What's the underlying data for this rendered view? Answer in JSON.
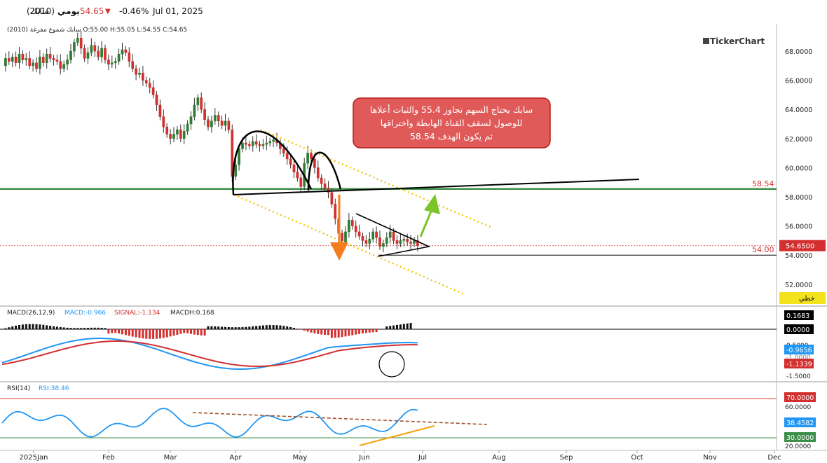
{
  "header": {
    "symbol": "سابك",
    "code": "(2010)",
    "period": "يومي",
    "price": "54.65",
    "change": "-0.46%",
    "date": "Jul 01, 2025",
    "ohlc_line": "سابك شموع مفرغة (2010) O:55.00 H:55.05 L:54.55 C:54.65",
    "brand": "TickerChart",
    "colors": {
      "down": "#d32f2f",
      "up": "#2e7d32"
    }
  },
  "annotation": {
    "line1": "سابك يحتاج السهم تجاوز 55.4 والثبات أعلاها",
    "line2": "للوصول لسقف القناة الهابطة واختراقها",
    "line3": "ثم يكون الهدف 58.54",
    "bg": "#e05a5a"
  },
  "levels": {
    "target_label": "58.54",
    "support_label": "54.00",
    "last_price_label": "54.6500",
    "linear_label": "خطي"
  },
  "price_axis": [
    "68.0000",
    "66.0000",
    "64.0000",
    "62.0000",
    "60.0000",
    "58.0000",
    "56.0000",
    "54.0000",
    "52.0000"
  ],
  "macd": {
    "title": "MACD(26,12,9)",
    "macd_label": "MACD:-0.966",
    "signal_label": "SIGNAL:-1.134",
    "hist_label": "MACDH:0.168",
    "axis": [
      "0.5000",
      "-1.5000"
    ],
    "axis_mid": "-1.0000",
    "tags": [
      "0.1683",
      "0.0000",
      "-0.9656",
      "-1.1339"
    ]
  },
  "rsi": {
    "title": "RSI(14)",
    "value_label": "RSI:38.46",
    "axis": [
      "60.0000",
      "20.0000"
    ],
    "tags": [
      "70.0000",
      "38.4582",
      "30.0000"
    ]
  },
  "x_axis": [
    "2025Jan",
    "Feb",
    "Mar",
    "Apr",
    "May",
    "Jun",
    "Jul",
    "Aug",
    "Sep",
    "Oct",
    "Nov",
    "Dec"
  ],
  "chart_data": {
    "type": "candlestick",
    "symbol": "سابك (2010)",
    "x_months": [
      "2025Jan",
      "Feb",
      "Mar",
      "Apr",
      "May",
      "Jun",
      "Jul",
      "Aug",
      "Sep",
      "Oct",
      "Nov",
      "Dec"
    ],
    "ylim": [
      51,
      69
    ],
    "last_ohlc": {
      "open": 55.0,
      "high": 55.05,
      "low": 54.55,
      "close": 54.65
    },
    "price_path": [
      [
        0,
        67.0
      ],
      [
        1,
        67.5
      ],
      [
        2,
        67.3
      ],
      [
        3,
        67.6
      ],
      [
        4,
        67.2
      ],
      [
        5,
        67.8
      ],
      [
        6,
        67.4
      ],
      [
        7,
        67.5
      ],
      [
        8,
        67.0
      ],
      [
        9,
        67.2
      ],
      [
        10,
        66.8
      ],
      [
        11,
        67.6
      ],
      [
        12,
        67.2
      ],
      [
        13,
        67.8
      ],
      [
        14,
        67.5
      ],
      [
        15,
        67.4
      ],
      [
        16,
        67.3
      ],
      [
        17,
        66.8
      ],
      [
        18,
        67.1
      ],
      [
        19,
        67.4
      ],
      [
        20,
        68.0
      ],
      [
        21,
        68.6
      ],
      [
        22,
        68.9
      ],
      [
        23,
        68.2
      ],
      [
        24,
        67.5
      ],
      [
        25,
        67.9
      ],
      [
        26,
        68.4
      ],
      [
        27,
        68.0
      ],
      [
        28,
        67.6
      ],
      [
        29,
        68.2
      ],
      [
        30,
        67.4
      ],
      [
        31,
        67.1
      ],
      [
        32,
        67.2
      ],
      [
        33,
        67.3
      ],
      [
        34,
        67.8
      ],
      [
        35,
        68.1
      ],
      [
        36,
        67.9
      ],
      [
        37,
        67.3
      ],
      [
        38,
        66.8
      ],
      [
        39,
        66.4
      ],
      [
        40,
        66.5
      ],
      [
        41,
        66.0
      ],
      [
        42,
        65.8
      ],
      [
        43,
        65.5
      ],
      [
        44,
        65.0
      ],
      [
        45,
        64.3
      ],
      [
        46,
        63.5
      ],
      [
        47,
        62.8
      ],
      [
        48,
        62.3
      ],
      [
        49,
        62.0
      ],
      [
        50,
        62.3
      ],
      [
        51,
        62.6
      ],
      [
        52,
        62.0
      ],
      [
        53,
        62.5
      ],
      [
        54,
        63.0
      ],
      [
        55,
        63.5
      ],
      [
        56,
        64.3
      ],
      [
        57,
        64.8
      ],
      [
        58,
        64.0
      ],
      [
        59,
        63.3
      ],
      [
        60,
        62.8
      ],
      [
        61,
        63.2
      ],
      [
        62,
        63.6
      ],
      [
        63,
        63.2
      ],
      [
        64,
        62.9
      ],
      [
        65,
        63.2
      ],
      [
        66,
        62.6
      ],
      [
        67,
        59.4
      ],
      [
        68,
        60.2
      ],
      [
        69,
        61.3
      ],
      [
        70,
        61.7
      ],
      [
        71,
        61.6
      ],
      [
        72,
        61.5
      ],
      [
        73,
        61.8
      ],
      [
        74,
        61.6
      ],
      [
        75,
        61.5
      ],
      [
        76,
        61.6
      ],
      [
        77,
        61.7
      ],
      [
        78,
        61.8
      ],
      [
        79,
        61.9
      ],
      [
        80,
        61.7
      ],
      [
        81,
        61.3
      ],
      [
        82,
        61.0
      ],
      [
        83,
        60.6
      ],
      [
        84,
        60.2
      ],
      [
        85,
        59.7
      ],
      [
        86,
        59.3
      ],
      [
        87,
        58.7
      ],
      [
        88,
        60.3
      ],
      [
        89,
        61.0
      ],
      [
        90,
        60.6
      ],
      [
        91,
        60.0
      ],
      [
        92,
        59.3
      ],
      [
        93,
        58.9
      ],
      [
        94,
        58.6
      ],
      [
        95,
        58.3
      ],
      [
        96,
        57.5
      ],
      [
        97,
        56.5
      ],
      [
        98,
        55.5
      ],
      [
        99,
        54.9
      ],
      [
        100,
        55.6
      ],
      [
        101,
        56.4
      ],
      [
        102,
        56.0
      ],
      [
        103,
        55.6
      ],
      [
        104,
        55.3
      ],
      [
        105,
        55.0
      ],
      [
        106,
        54.8
      ],
      [
        107,
        55.1
      ],
      [
        108,
        55.6
      ],
      [
        109,
        55.2
      ],
      [
        110,
        54.6
      ],
      [
        111,
        54.8
      ],
      [
        112,
        55.2
      ],
      [
        113,
        55.6
      ],
      [
        114,
        55.0
      ],
      [
        115,
        54.8
      ],
      [
        116,
        55.0
      ],
      [
        117,
        55.1
      ],
      [
        118,
        54.9
      ],
      [
        119,
        54.8
      ],
      [
        120,
        55.0
      ],
      [
        121,
        54.65
      ]
    ],
    "horizontal_levels": {
      "target": 58.54,
      "support": 54.0,
      "last": 54.65
    },
    "macd": {
      "macd": -0.9656,
      "signal": -1.1339,
      "histogram": 0.1683
    },
    "rsi": {
      "value": 38.4582,
      "overbought": 70,
      "oversold": 30
    }
  }
}
